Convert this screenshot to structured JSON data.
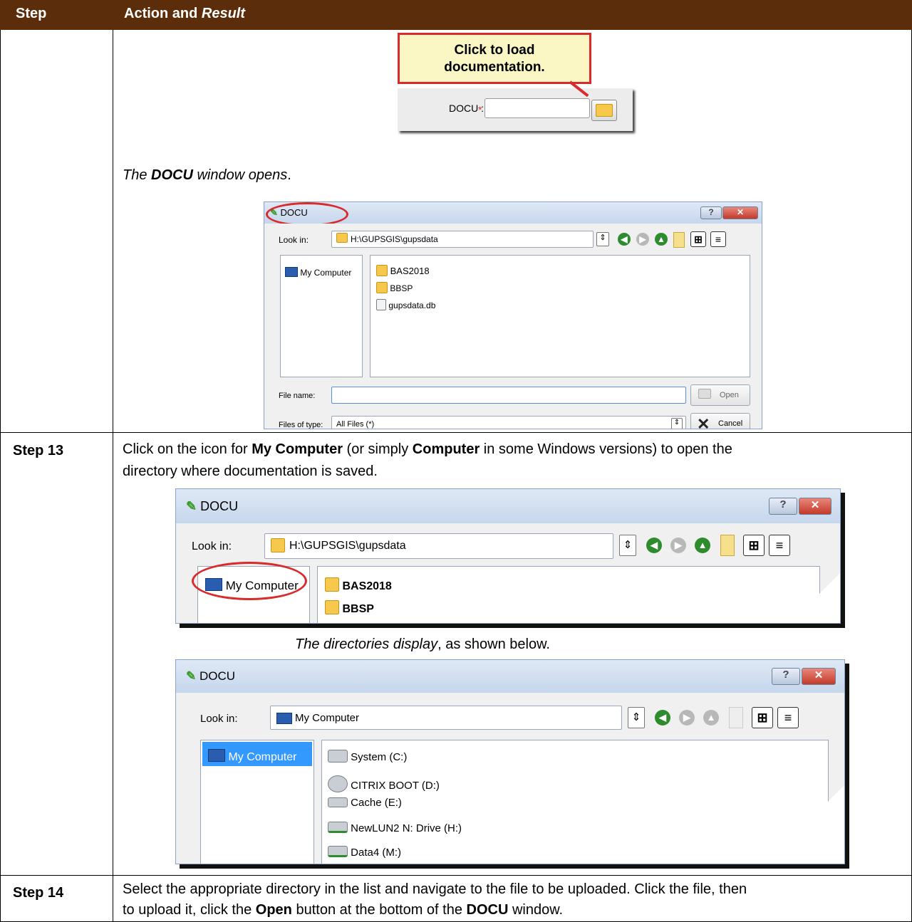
{
  "table": {
    "header_step": "Step",
    "header_action_prefix": "Action and ",
    "header_action_italic": "Result"
  },
  "callout": {
    "line1": "Click to load",
    "line2": "documentation.",
    "docu_label": "DOCU :",
    "required_mark": "*"
  },
  "row12": {
    "opens_italic1": "The ",
    "opens_bold": "DOCU",
    "opens_italic2": " window opens",
    "opens_end": "."
  },
  "dialog1": {
    "title": "DOCU",
    "look_in_label": "Look in:",
    "look_in_value": "H:\\GUPSGIS\\gupsdata",
    "sidebar_item": "My Computer",
    "files": [
      "BAS2018",
      "BBSP",
      "gupsdata.db"
    ],
    "file_name_label": "File name:",
    "file_name_value": "",
    "open_button": "Open",
    "files_of_type_label": "Files of type:",
    "files_of_type_value": "All Files (*)",
    "cancel_button": "Cancel",
    "help_button": "?",
    "close_button": "✕"
  },
  "step13": {
    "label": "Step 13",
    "text_a": "Click on the icon for ",
    "text_b": "My Computer",
    "text_c": " (or simply ",
    "text_d": "Computer",
    "text_e": " in some Windows versions) to open the",
    "text_line2": "directory where documentation is saved.",
    "dirs_italic": "The directories display",
    "dirs_rest": ", as shown below."
  },
  "dialog2": {
    "title": "DOCU",
    "look_in_label": "Look in:",
    "look_in_value": "H:\\GUPSGIS\\gupsdata",
    "sidebar_item": "My Computer",
    "files": [
      "BAS2018",
      "BBSP"
    ],
    "help_button": "?",
    "close_button": "✕"
  },
  "dialog3": {
    "title": "DOCU",
    "look_in_label": "Look in:",
    "look_in_value": "My Computer",
    "sidebar_item": "My Computer",
    "drives": [
      "System (C:)",
      "CITRIX BOOT (D:)",
      "Cache (E:)",
      "NewLUN2 N: Drive (H:)",
      "Data4 (M:)"
    ],
    "help_button": "?",
    "close_button": "✕"
  },
  "step14": {
    "label": "Step 14",
    "line1": "Select the appropriate directory in the list and navigate to the file to be uploaded. Click the file, then",
    "line2_a": "to upload it, click the ",
    "line2_b": "Open",
    "line2_c": " button at the bottom of the ",
    "line2_d": "DOCU",
    "line2_e": " window."
  }
}
